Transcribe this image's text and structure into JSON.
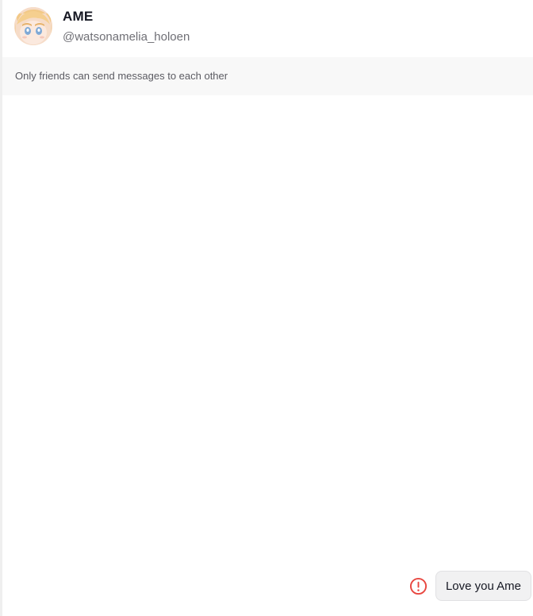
{
  "header": {
    "display_name": "AME",
    "username": "@watsonamelia_holoen",
    "avatar_icon": "user-avatar-icon"
  },
  "notice": {
    "text": "Only friends can send messages to each other"
  },
  "messages": [
    {
      "text": "Love you Ame",
      "direction": "outgoing",
      "status": "failed",
      "status_icon": "error-icon"
    }
  ],
  "colors": {
    "error": "#e8463f",
    "bubble_bg": "#f1f1f2",
    "notice_bg": "#f8f8f8"
  }
}
